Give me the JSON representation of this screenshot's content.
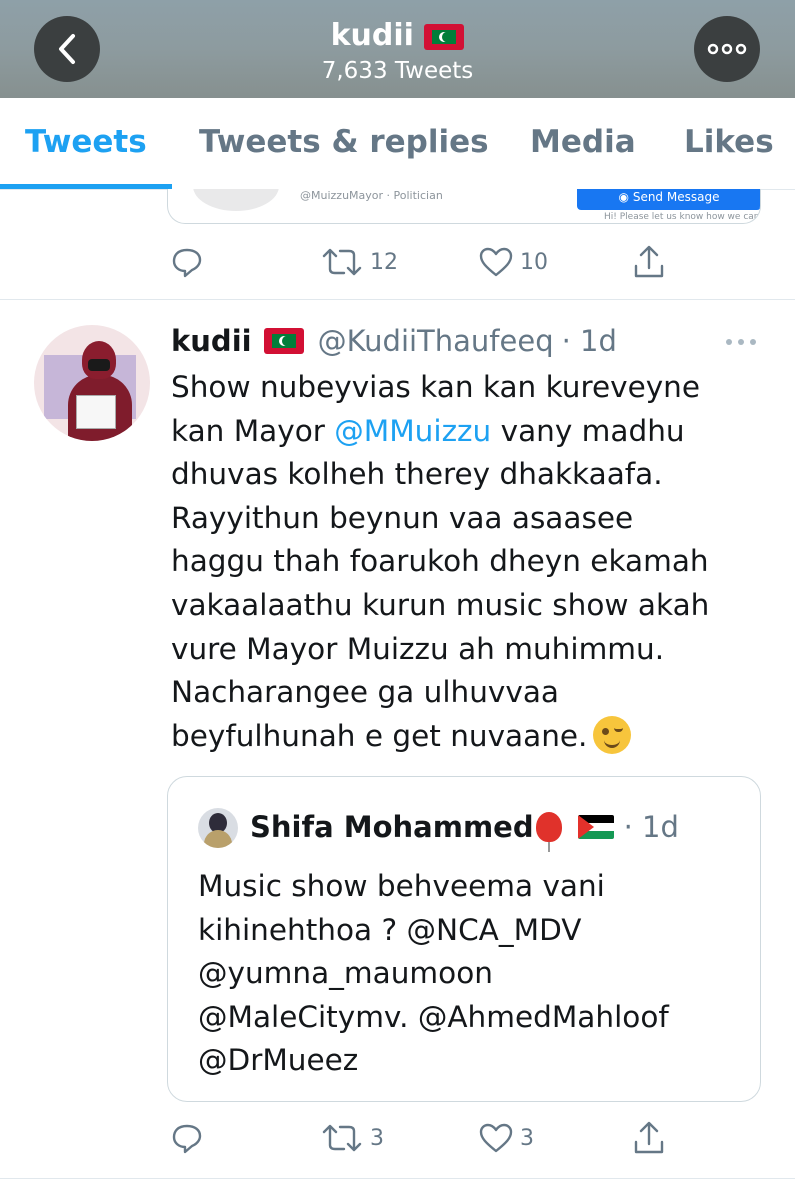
{
  "header": {
    "name": "kudii",
    "tweet_count": "7,633 Tweets",
    "icons": {
      "back": "chevron-left-icon",
      "more": "more-horizontal-icon",
      "flag": "maldives-flag-icon"
    }
  },
  "tabs": [
    {
      "label": "Tweets",
      "active": true
    },
    {
      "label": "Tweets & replies",
      "active": false
    },
    {
      "label": "Media",
      "active": false
    },
    {
      "label": "Likes",
      "active": false
    }
  ],
  "prev_tweet": {
    "card_handle": "@MuizzuMayor · Politician",
    "card_button": "Send Message",
    "card_note": "Hi! Please let us know how we can h",
    "retweets": "12",
    "likes": "10"
  },
  "tweet": {
    "name": "kudii",
    "handle": "@KudiiThaufeeq",
    "time": "· 1d",
    "text_lines": [
      "Show nubeyvias kan kan kureveyne",
      "kan Mayor ",
      "@MMuizzu",
      " vany madhu",
      "dhuvas kolheh therey dhakkaafa.",
      "Rayyithun beynun vaa asaasee",
      "haggu thah foarukoh dheyn ekamah",
      "vakaalaathu kurun music show akah",
      "vure Mayor Muizzu ah muhimmu.",
      "Nacharangee ga ulhuvvaa",
      "beyfulhunah e get nuvaane."
    ],
    "quote": {
      "name": "Shifa Mohammed",
      "time": "· 1d",
      "text_lines": [
        "Music show behveema  vani",
        "kihinehthoa ? @NCA_MDV",
        "@yumna_maumoon",
        "@MaleCitymv. @AhmedMahloof",
        "@DrMueez"
      ]
    },
    "retweets": "3",
    "likes": "3"
  },
  "colors": {
    "accent": "#1da1f2",
    "muted": "#657786"
  }
}
